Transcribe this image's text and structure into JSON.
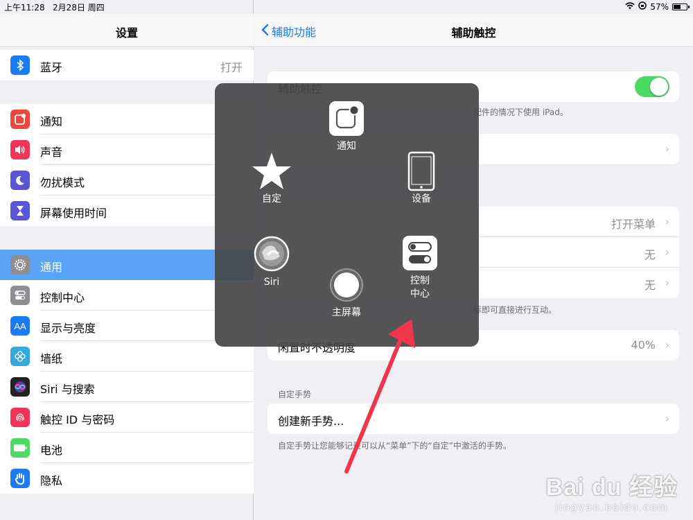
{
  "status_bar": {
    "time": "上午11:28",
    "date": "2月28日 周四",
    "battery": "57%",
    "battery_level": 0.57
  },
  "left": {
    "title": "设置",
    "rows": [
      {
        "label": "蓝牙",
        "value": "打开",
        "icon": "bluetooth-icon",
        "color": "#1a7bf2"
      },
      {
        "label": "通知",
        "icon": "notifications-icon",
        "color": "#f2453d"
      },
      {
        "label": "声音",
        "icon": "sound-icon",
        "color": "#f0345a"
      },
      {
        "label": "勿扰模式",
        "icon": "moon-icon",
        "color": "#5a55d6"
      },
      {
        "label": "屏幕使用时间",
        "icon": "hourglass-icon",
        "color": "#5a55d6"
      },
      {
        "label": "通用",
        "icon": "gear-icon",
        "color": "#8e8e93"
      },
      {
        "label": "控制中心",
        "icon": "control-center-icon",
        "color": "#8e8e93"
      },
      {
        "label": "显示与亮度",
        "icon": "display-icon",
        "color": "#1a7bf2"
      },
      {
        "label": "墙纸",
        "icon": "wallpaper-icon",
        "color": "#34aadc"
      },
      {
        "label": "Siri 与搜索",
        "icon": "siri-icon",
        "color": "#222"
      },
      {
        "label": "触控 ID 与密码",
        "icon": "fingerprint-icon",
        "color": "#f0345a"
      },
      {
        "label": "电池",
        "icon": "battery-icon",
        "color": "#4cd964"
      },
      {
        "label": "隐私",
        "icon": "hand-icon",
        "color": "#1a7bf2"
      }
    ]
  },
  "right": {
    "back_label": "辅助功能",
    "title": "辅助触控",
    "assistive_touch": {
      "label": "辅助触控",
      "enabled": true
    },
    "assistive_footnote": "配件的情况下使用 iPad。",
    "top_level_value": "打开菜单",
    "action1_value": "无",
    "action2_value": "无",
    "action_footnote": "标即可直接进行互动。",
    "idle_opacity_label": "闲置时不透明度",
    "idle_opacity_value": "40%",
    "custom_section": "自定手势",
    "create_gesture": "创建新手势...",
    "custom_footnote": "自定手势让您能够记录可以从“菜单”下的“自定”中激活的手势。"
  },
  "at_menu": {
    "notification": "通知",
    "custom": "自定",
    "device": "设备",
    "siri": "Siri",
    "control_center": "控制\n中心",
    "home": "主屏幕"
  },
  "watermark": {
    "logo": "Bai du 经验",
    "sub": "jingyan.baidu.com"
  }
}
